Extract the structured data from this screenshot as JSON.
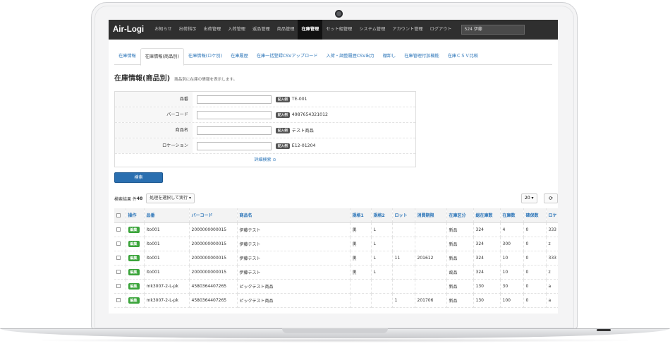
{
  "nav": {
    "brand": "Air-Logi",
    "items": [
      "お知らせ",
      "出荷指示",
      "出荷管理",
      "入荷管理",
      "返品管理",
      "商品管理",
      "在庫管理",
      "セット組管理",
      "システム管理",
      "アカウント管理",
      "ログアウト"
    ],
    "active_index": 6,
    "search_value": "524 伊藤"
  },
  "tabs": {
    "items": [
      "在庫情報",
      "在庫情報(商品別)",
      "在庫情報(ロケ別)",
      "在庫履歴",
      "在庫一括登録CSVアップロード",
      "入荷・調整履歴CSV出力",
      "棚卸し",
      "在庫管理付加機能",
      "在庫ＣＳＶ比較"
    ],
    "active_index": 1
  },
  "page": {
    "title": "在庫情報(商品別)",
    "description": "商品別に在庫の情報を表示します。"
  },
  "search_form": {
    "fields": [
      {
        "label": "品番",
        "example_badge": "記入例",
        "example": "TE-001"
      },
      {
        "label": "バーコード",
        "example_badge": "記入例",
        "example": "4987654321012"
      },
      {
        "label": "商品名",
        "example_badge": "記入例",
        "example": "テスト商品"
      },
      {
        "label": "ロケーション",
        "example_badge": "記入例",
        "example": "E12-01204"
      }
    ],
    "detail_link": "詳細検索 ⊙",
    "search_button": "検索"
  },
  "results": {
    "label": "検索結果 件",
    "count": "48",
    "action_select": "処理を選択して実行 ▾",
    "page_size": "20 ▾",
    "refresh_icon": "⟳"
  },
  "table": {
    "headers": [
      "",
      "操作",
      "品番",
      "バーコード",
      "商品名",
      "規格1",
      "規格2",
      "ロット",
      "消費期限",
      "在庫区分",
      "総在庫数",
      "在庫数",
      "確保数",
      "ロケ"
    ],
    "edit_label": "編集",
    "rows": [
      [
        "ito001",
        "2000000000015",
        "伊藤テスト",
        "黒",
        "L",
        "",
        "",
        "新品",
        "324",
        "4",
        "0",
        "333"
      ],
      [
        "ito001",
        "2000000000015",
        "伊藤テスト",
        "黒",
        "L",
        "",
        "",
        "新品",
        "324",
        "300",
        "0",
        "z"
      ],
      [
        "ito001",
        "2000000000015",
        "伊藤テスト",
        "黒",
        "L",
        "11",
        "201612",
        "新品",
        "324",
        "10",
        "0",
        "333"
      ],
      [
        "ito001",
        "2000000000015",
        "伊藤テスト",
        "黒",
        "L",
        "",
        "",
        "故品",
        "324",
        "10",
        "0",
        "z"
      ],
      [
        "mk3007-2-L-pk",
        "4580364407265",
        "ピックテスト商品",
        "",
        "",
        "",
        "",
        "新品",
        "130",
        "30",
        "0",
        "a"
      ],
      [
        "mk3007-2-L-pk",
        "4580364407265",
        "ピックテスト商品",
        "",
        "",
        "1",
        "201706",
        "新品",
        "130",
        "100",
        "0",
        "a"
      ]
    ]
  },
  "colors": {
    "navbar": "#2f2f2f",
    "link": "#2a74b8",
    "primary_button": "#2a6fb0",
    "edit_button": "#3aa43a"
  }
}
